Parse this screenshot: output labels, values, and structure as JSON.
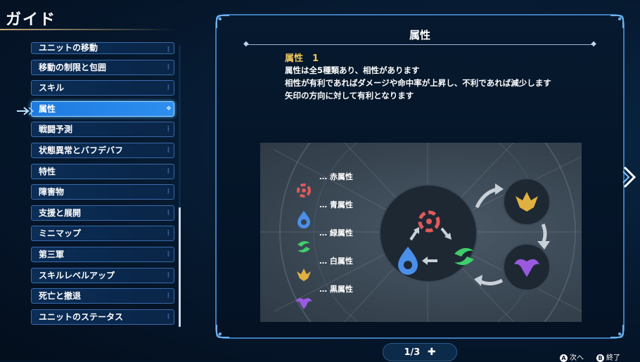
{
  "screen_title": "ガイド",
  "menu": {
    "items": [
      {
        "label": "ユニットの移動"
      },
      {
        "label": "移動の制限と包囲"
      },
      {
        "label": "スキル"
      },
      {
        "label": "属性"
      },
      {
        "label": "戦闘予測"
      },
      {
        "label": "状態異常とバフデバフ"
      },
      {
        "label": "特性"
      },
      {
        "label": "障害物"
      },
      {
        "label": "支援と展開"
      },
      {
        "label": "ミニマップ"
      },
      {
        "label": "第三軍"
      },
      {
        "label": "スキルレベルアップ"
      },
      {
        "label": "死亡と撤退"
      },
      {
        "label": "ユニットのステータス"
      }
    ],
    "selected_index": 3
  },
  "panel": {
    "title": "属性",
    "subtitle": "属性　1",
    "lines": [
      "属性は全5種類あり、相性があります",
      "相性が有利であればダメージや命中率が上昇し、不利であれば減少します",
      "矢印の方向に対して有利となります"
    ],
    "legend": [
      {
        "label": "… 赤属性",
        "icon": "red-element-icon",
        "color": "#e05a5a"
      },
      {
        "label": "… 青属性",
        "icon": "blue-element-icon",
        "color": "#4a8fe8"
      },
      {
        "label": "… 緑属性",
        "icon": "green-element-icon",
        "color": "#3fcf6a"
      },
      {
        "label": "… 白属性",
        "icon": "white-element-icon",
        "color": "#e0b040"
      },
      {
        "label": "… 黒属性",
        "icon": "black-element-icon",
        "color": "#9a5ae0"
      }
    ]
  },
  "pagination": {
    "label": "1/3"
  },
  "hints": {
    "a_button": "A",
    "a_label": "次へ",
    "b_button": "B",
    "b_label": "終了"
  }
}
